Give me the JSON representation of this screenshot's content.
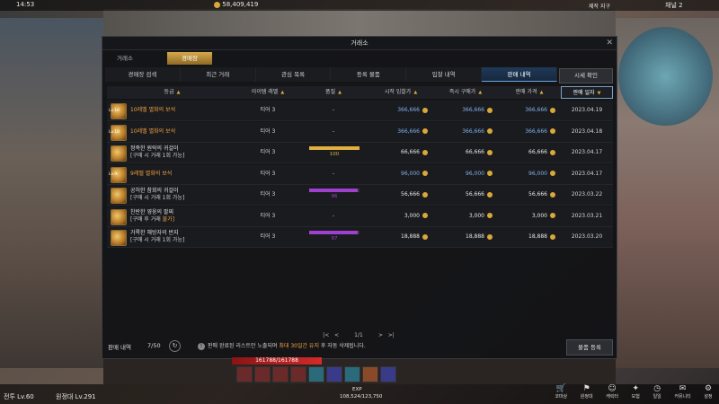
{
  "hud": {
    "time": "14:53",
    "gold": "58,409,419",
    "zone": "제작 지구",
    "channel": "채널 2",
    "char_class": "전투 Lv.60",
    "expedition": "원정대 Lv.291",
    "hp": "161788/161788",
    "exp_label": "EXP",
    "exp_value": "108,524/123,750"
  },
  "window": {
    "title": "거래소",
    "tabs": [
      "거래소",
      "경매장"
    ],
    "subtabs": [
      "경매장 검색",
      "최근 거래",
      "관심 목록",
      "등록 물품",
      "입찰 내역",
      "판매 내역"
    ],
    "price_check_button": "시세 확인",
    "columns": [
      "등급",
      "아이템 레벨",
      "품질",
      "시작 입찰가",
      "즉시 구매가",
      "판매 가격",
      "판매 일자"
    ],
    "rows": [
      {
        "name": "10레벨 멸화의 보석",
        "sub": "",
        "sub_hl": "",
        "tier": "티어 3",
        "quality": "-",
        "start": "366,666",
        "buy": "366,666",
        "sale": "366,666",
        "date": "2023.04.19",
        "lvl": "Lv.10"
      },
      {
        "name": "10레벨 멸화의 보석",
        "sub": "",
        "sub_hl": "",
        "tier": "티어 3",
        "quality": "-",
        "start": "366,666",
        "buy": "366,666",
        "sale": "366,666",
        "date": "2023.04.18",
        "lvl": "Lv.10"
      },
      {
        "name": "정족한 원락의 귀걸이",
        "sub": "[구매 시 거래 1회 가능]",
        "sub_hl": "",
        "tier": "티어 3",
        "quality": "100",
        "start": "66,666",
        "buy": "66,666",
        "sale": "66,666",
        "date": "2023.04.17",
        "lvl": ""
      },
      {
        "name": "9레벨 멸화의 보석",
        "sub": "",
        "sub_hl": "",
        "tier": "티어 3",
        "quality": "-",
        "start": "96,000",
        "buy": "96,000",
        "sale": "96,000",
        "date": "2023.04.17",
        "lvl": "Lv.9"
      },
      {
        "name": "공허한 참회의 귀걸이",
        "sub": "[구매 시 거래 1회 가능]",
        "sub_hl": "",
        "tier": "티어 3",
        "quality": "96",
        "start": "56,666",
        "buy": "56,666",
        "sale": "56,666",
        "date": "2023.03.22",
        "lvl": ""
      },
      {
        "name": "찬란한 영웅의 팔찌",
        "sub": "[구매 후 거래 ",
        "sub_hl": "불가]",
        "tier": "티어 3",
        "quality": "-",
        "start": "3,000",
        "buy": "3,000",
        "sale": "3,000",
        "date": "2023.03.21",
        "lvl": ""
      },
      {
        "name": "거록한 해방자의 반지",
        "sub": "[구매 시 거래 1회 가능]",
        "sub_hl": "",
        "tier": "티어 3",
        "quality": "97",
        "start": "18,888",
        "buy": "18,888",
        "sale": "18,888",
        "date": "2023.03.20",
        "lvl": ""
      }
    ],
    "pager": "1/1",
    "footer_label": "판매 내역",
    "footer_count": "7/50",
    "info_pre": "판매 완료된 리스트만 노출되며 ",
    "info_hl": "최대 30일간 유지",
    "info_post": " 후 자동 삭제됩니다.",
    "register_button": "물품 등록"
  },
  "bottom_menu": [
    "코마상",
    "원정대",
    "캐릭터",
    "모험",
    "일일",
    "커뮤니티",
    "설정"
  ],
  "colors": {
    "quality_yellow": "#e0b040",
    "quality_purple": "#a040d0",
    "accent_gold": "#d8a93a",
    "price_blue": "#7fb2ea"
  }
}
